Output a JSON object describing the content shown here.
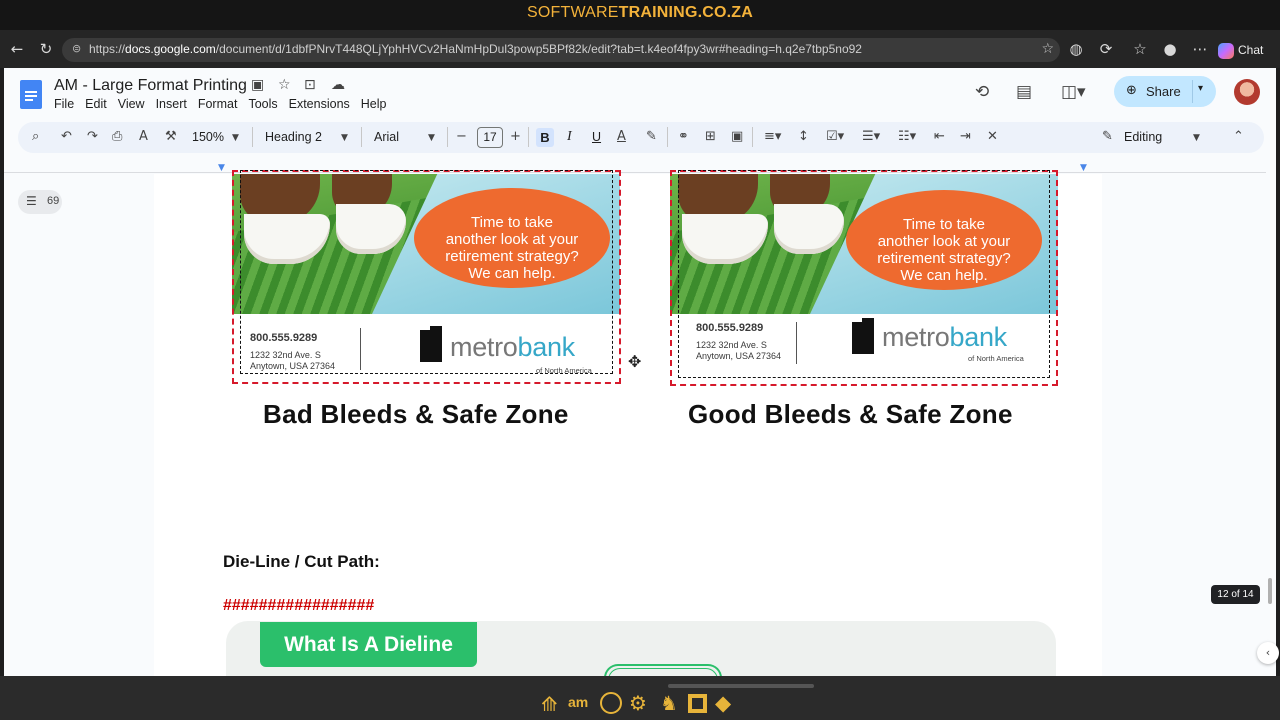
{
  "banner": {
    "prefix": "SOFTWARE",
    "main": "TRAINING.CO.ZA"
  },
  "browser": {
    "url_prefix": "https://",
    "url_host": "docs.google.com",
    "url_path": "/document/d/1dbfPNrvT448QLjYphHVCv2HaNmHpDul3powp5BPf82k/edit?tab=t.k4eof4fpy3wr#heading=h.q2e7tbp5no92",
    "chat_label": "Chat"
  },
  "doc": {
    "title": "AM - Large Format Printing",
    "menus": [
      "File",
      "Edit",
      "View",
      "Insert",
      "Format",
      "Tools",
      "Extensions",
      "Help"
    ],
    "share_label": "Share",
    "editing_label": "Editing"
  },
  "toolbar": {
    "zoom": "150%",
    "style": "Heading 2",
    "font": "Arial",
    "font_size": "17",
    "bold": "B",
    "italic": "I",
    "underline": "U"
  },
  "outline": {
    "count": "69"
  },
  "cards": {
    "tagline_1": "Time to take",
    "tagline_2": "another look at your",
    "tagline_3": "retirement strategy?",
    "tagline_4": "We can help.",
    "phone": "800.555.9289",
    "address_1": "1232 32nd Ave. S",
    "address_2": "Anytown, USA 27364",
    "brand_a": "metro",
    "brand_b": "bank",
    "brand_sub": "of North America"
  },
  "captions": {
    "bad": "Bad Bleeds & Safe Zone",
    "good": "Good Bleeds & Safe Zone"
  },
  "content": {
    "dieline_heading": "Die-Line / Cut Path:",
    "hashes": "#################",
    "dieline_badge": "What Is A Dieline"
  },
  "page_indicator": "12 of 14",
  "colors": {
    "accent": "#f3b23a",
    "share_bg": "#c2e7ff",
    "bleed_red": "#d6192b",
    "dieline_green": "#2bbf6b"
  }
}
